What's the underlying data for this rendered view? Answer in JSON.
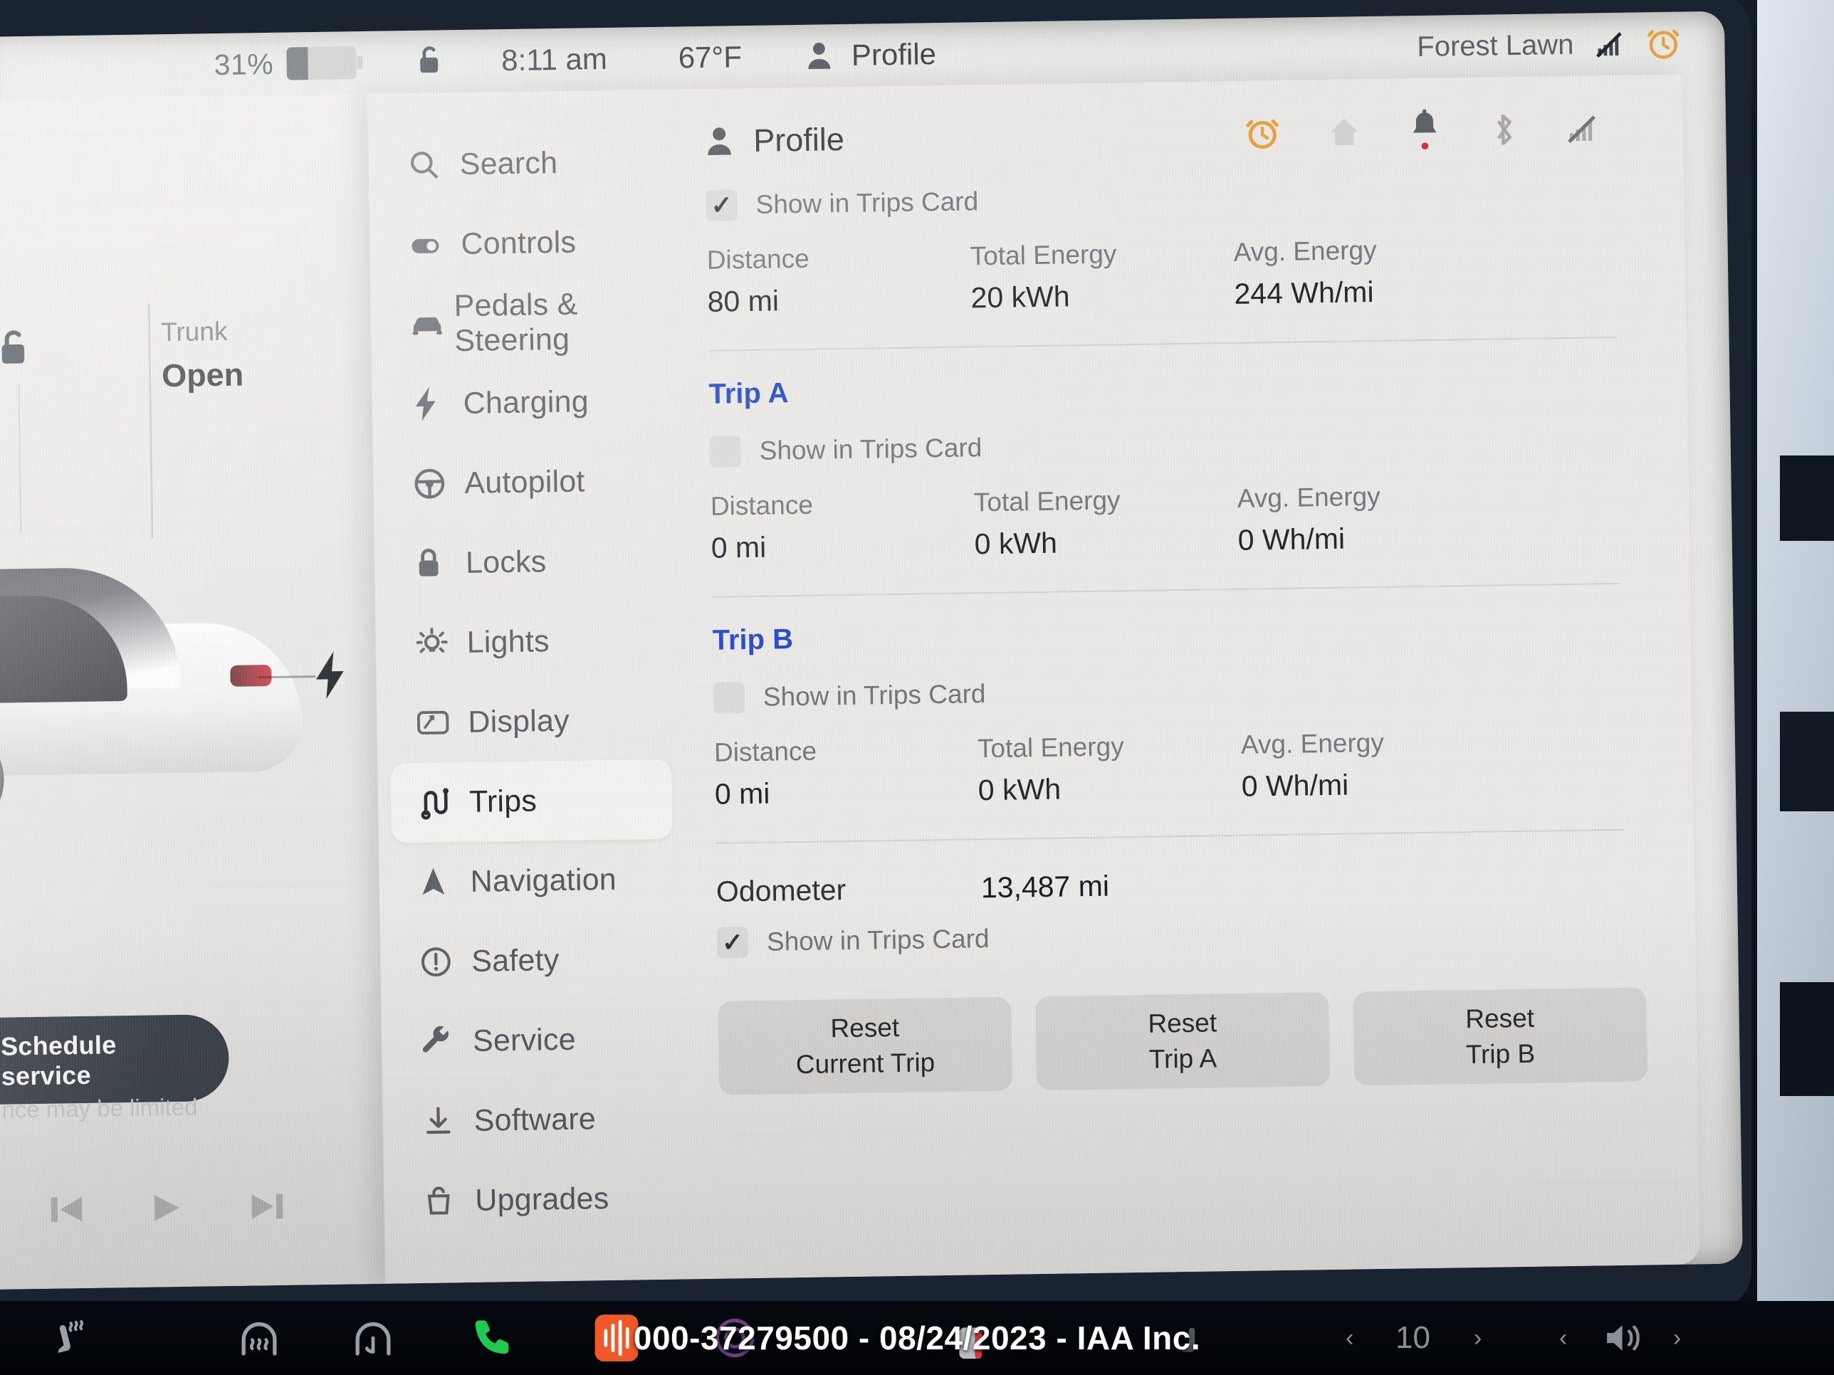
{
  "status_bar": {
    "battery_percent": "31%",
    "battery_level": 31,
    "lock_icon": "unlocked-padlock-icon",
    "time": "8:11 am",
    "temperature": "67°F",
    "profile_label": "Profile",
    "location": "Forest Lawn",
    "signal_icon": "no-signal-icon",
    "alarm_icon": "alarm-clock-icon"
  },
  "left_panel": {
    "trunk_label": "Trunk",
    "trunk_state": "Open",
    "lock_icon": "unlocked-padlock-icon",
    "charge_icon": "charge-bolt-icon",
    "service_banner": {
      "line1": "Schedule service",
      "line2": "nce may be limited"
    },
    "media": {
      "previous": "⏮",
      "play": "▶",
      "next": "⏭"
    }
  },
  "sidebar": {
    "items": [
      {
        "label": "Search",
        "icon": "search-icon",
        "active": false
      },
      {
        "label": "Controls",
        "icon": "toggle-icon",
        "active": false
      },
      {
        "label": "Pedals & Steering",
        "icon": "car-front-icon",
        "active": false
      },
      {
        "label": "Charging",
        "icon": "bolt-icon",
        "active": false
      },
      {
        "label": "Autopilot",
        "icon": "steering-wheel-icon",
        "active": false
      },
      {
        "label": "Locks",
        "icon": "padlock-icon",
        "active": false
      },
      {
        "label": "Lights",
        "icon": "lightbulb-icon",
        "active": false
      },
      {
        "label": "Display",
        "icon": "display-icon",
        "active": false
      },
      {
        "label": "Trips",
        "icon": "trips-route-icon",
        "active": true
      },
      {
        "label": "Navigation",
        "icon": "navigation-arrow-icon",
        "active": false
      },
      {
        "label": "Safety",
        "icon": "exclamation-circle-icon",
        "active": false
      },
      {
        "label": "Service",
        "icon": "wrench-icon",
        "active": false
      },
      {
        "label": "Software",
        "icon": "download-icon",
        "active": false
      },
      {
        "label": "Upgrades",
        "icon": "shopping-bag-icon",
        "active": false
      }
    ]
  },
  "content": {
    "title": "Profile",
    "title_icon": "person-icon",
    "header_icons": [
      "alarm-clock-icon",
      "home-icon",
      "bell-notification-icon",
      "bluetooth-icon",
      "no-signal-icon"
    ],
    "current_trip": {
      "show_in_trips_card_label": "Show in Trips Card",
      "show_in_trips_card_checked": true,
      "stats": [
        {
          "key": "Distance",
          "value": "80 mi"
        },
        {
          "key": "Total Energy",
          "value": "20 kWh"
        },
        {
          "key": "Avg. Energy",
          "value": "244 Wh/mi"
        }
      ]
    },
    "trip_a": {
      "title": "Trip A",
      "show_in_trips_card_label": "Show in Trips Card",
      "show_in_trips_card_checked": false,
      "stats": [
        {
          "key": "Distance",
          "value": "0 mi"
        },
        {
          "key": "Total Energy",
          "value": "0 kWh"
        },
        {
          "key": "Avg. Energy",
          "value": "0 Wh/mi"
        }
      ]
    },
    "trip_b": {
      "title": "Trip B",
      "show_in_trips_card_label": "Show in Trips Card",
      "show_in_trips_card_checked": false,
      "stats": [
        {
          "key": "Distance",
          "value": "0 mi"
        },
        {
          "key": "Total Energy",
          "value": "0 kWh"
        },
        {
          "key": "Avg. Energy",
          "value": "0 Wh/mi"
        }
      ]
    },
    "odometer": {
      "label": "Odometer",
      "value": "13,487 mi",
      "show_in_trips_card_label": "Show in Trips Card",
      "show_in_trips_card_checked": true
    },
    "buttons": [
      {
        "line1": "Reset",
        "line2": "Current Trip"
      },
      {
        "line1": "Reset",
        "line2": "Trip A"
      },
      {
        "line1": "Reset",
        "line2": "Trip B"
      }
    ]
  },
  "taskbar": {
    "icons": [
      "seat-heater-icon",
      "defrost-rear-icon",
      "defrost-front-icon",
      "phone-icon",
      "voice-wave-icon",
      "fan-icon",
      "seat-heater-icon"
    ],
    "watermark": "000-37279500 - 08/24/2023 - IAA Inc.",
    "left_chevron": "‹",
    "right_chevron": "›",
    "temperature_control": "10",
    "volume_icon": "volume-icon"
  },
  "colors": {
    "accent_blue": "#1f44c8",
    "alarm_orange": "#e8a33d",
    "notification_red": "#e8213c",
    "screen_bg": "#e9e9e7",
    "card_bg": "#eceae8"
  }
}
